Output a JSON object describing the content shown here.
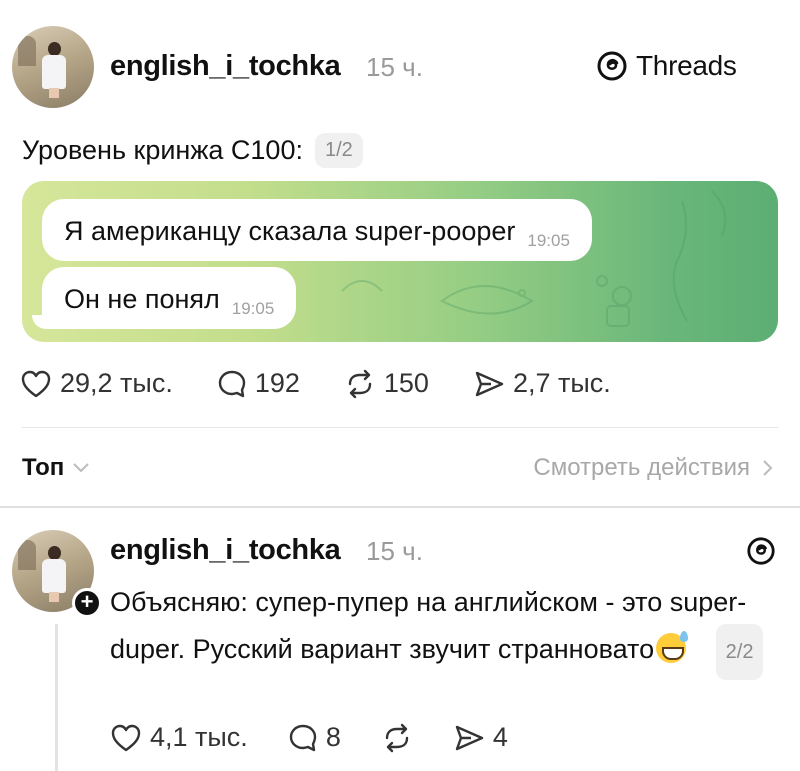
{
  "post": {
    "username": "english_i_tochka",
    "time": "15 ч.",
    "brand": "Threads",
    "text": "Уровень кринжа C100:",
    "page_indicator": "1/2",
    "media": {
      "bubbles": [
        {
          "text": "Я американцу сказала super-pooper",
          "time": "19:05"
        },
        {
          "text": "Он не понял",
          "time": "19:05"
        }
      ]
    },
    "stats": {
      "likes": "29,2 тыс.",
      "comments": "192",
      "reposts": "150",
      "shares": "2,7 тыс."
    }
  },
  "replies_header": {
    "sort_label": "Топ",
    "view_activity": "Смотреть действия"
  },
  "reply": {
    "username": "english_i_tochka",
    "time": "15 ч.",
    "text": "Объясняю: супер-пупер на английском - это super-duper. Русский вариант звучит странновато",
    "page_indicator": "2/2",
    "stats": {
      "likes": "4,1 тыс.",
      "comments": "8",
      "shares": "4"
    }
  },
  "colors": {
    "chat_gradient_left": "#d6e69a",
    "chat_gradient_right": "#5cae74",
    "muted": "#9a9a9a"
  },
  "icons": [
    "threads-logo-icon",
    "heart-icon",
    "comment-icon",
    "repost-icon",
    "share-icon",
    "chevron-down-icon",
    "chevron-right-icon",
    "plus-icon",
    "sweat-smile-emoji"
  ]
}
